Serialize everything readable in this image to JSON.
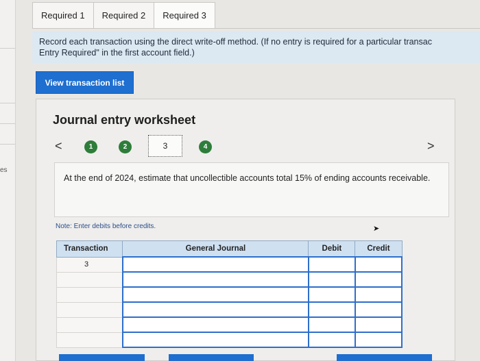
{
  "tabs": [
    {
      "label": "Required 1"
    },
    {
      "label": "Required 2"
    },
    {
      "label": "Required 3"
    }
  ],
  "instruction": {
    "line1": "Record each transaction using the direct write-off method. (If no entry is required for a particular transac",
    "line2": "Entry Required\" in the first account field.)"
  },
  "view_button": "View transaction list",
  "worksheet": {
    "title": "Journal entry worksheet",
    "nav": {
      "prev": "<",
      "next": ">"
    },
    "steps": [
      "1",
      "2",
      "3",
      "4"
    ],
    "current_step": "3",
    "description": "At the end of 2024, estimate that uncollectible accounts total 15% of ending accounts receivable.",
    "note": "Note: Enter debits before credits.",
    "table": {
      "headers": [
        "Transaction",
        "General Journal",
        "Debit",
        "Credit"
      ],
      "rows": [
        {
          "transaction": "3",
          "account": "",
          "debit": "",
          "credit": ""
        },
        {
          "transaction": "",
          "account": "",
          "debit": "",
          "credit": ""
        },
        {
          "transaction": "",
          "account": "",
          "debit": "",
          "credit": ""
        },
        {
          "transaction": "",
          "account": "",
          "debit": "",
          "credit": ""
        },
        {
          "transaction": "",
          "account": "",
          "debit": "",
          "credit": ""
        },
        {
          "transaction": "",
          "account": "",
          "debit": "",
          "credit": ""
        }
      ]
    }
  },
  "side": {
    "fragment": "es"
  },
  "colors": {
    "accent": "#1e6fd0",
    "step_done": "#2e7d3a",
    "table_header": "#cfe0f1",
    "instruction_bg": "#dce8f2"
  }
}
